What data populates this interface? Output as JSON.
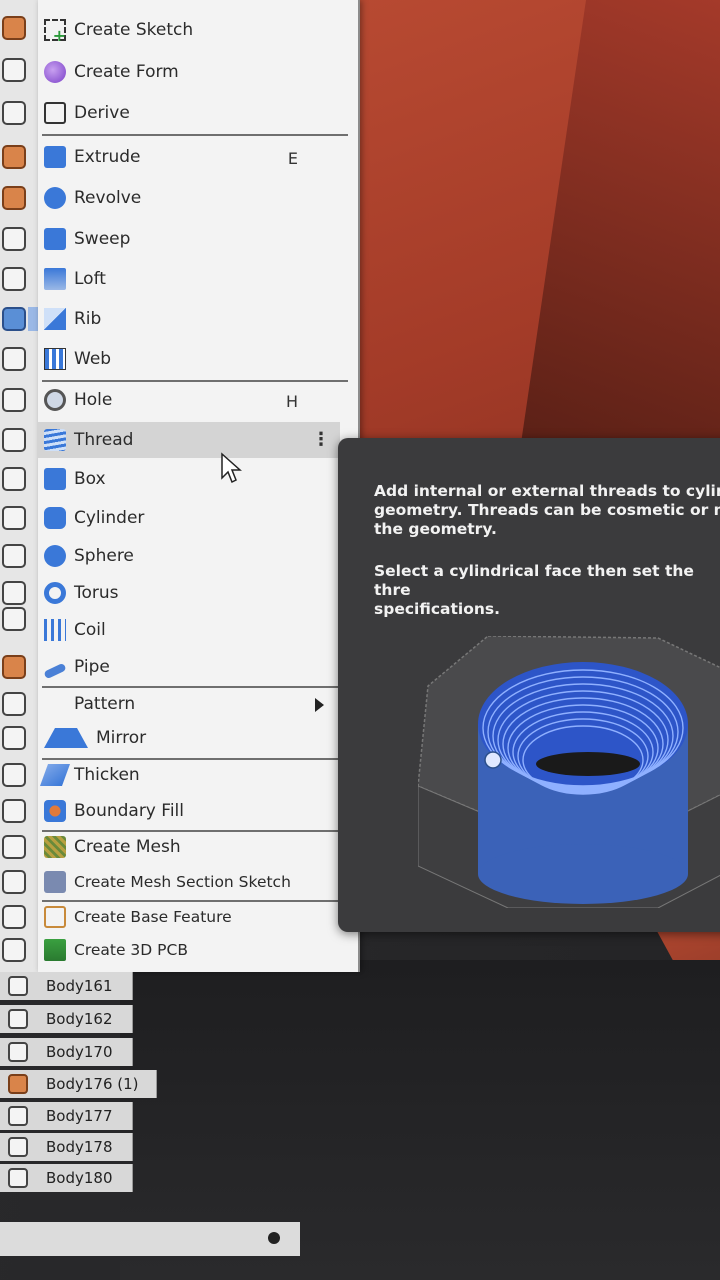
{
  "menu": {
    "items": [
      {
        "id": "create-sketch",
        "label": "Create Sketch",
        "icon": "create-sketch-icon",
        "shortcut": ""
      },
      {
        "id": "create-form",
        "label": "Create Form",
        "icon": "create-form-icon",
        "shortcut": ""
      },
      {
        "id": "derive",
        "label": "Derive",
        "icon": "derive-icon",
        "shortcut": ""
      },
      {
        "id": "extrude",
        "label": "Extrude",
        "icon": "extrude-icon",
        "shortcut": "E"
      },
      {
        "id": "revolve",
        "label": "Revolve",
        "icon": "revolve-icon",
        "shortcut": ""
      },
      {
        "id": "sweep",
        "label": "Sweep",
        "icon": "sweep-icon",
        "shortcut": ""
      },
      {
        "id": "loft",
        "label": "Loft",
        "icon": "loft-icon",
        "shortcut": ""
      },
      {
        "id": "rib",
        "label": "Rib",
        "icon": "rib-icon",
        "shortcut": ""
      },
      {
        "id": "web",
        "label": "Web",
        "icon": "web-icon",
        "shortcut": ""
      },
      {
        "id": "hole",
        "label": "Hole",
        "icon": "hole-icon",
        "shortcut": "H"
      },
      {
        "id": "thread",
        "label": "Thread",
        "icon": "thread-icon",
        "shortcut": "",
        "more": "⋮"
      },
      {
        "id": "box",
        "label": "Box",
        "icon": "box-icon",
        "shortcut": ""
      },
      {
        "id": "cylinder",
        "label": "Cylinder",
        "icon": "cylinder-icon",
        "shortcut": ""
      },
      {
        "id": "sphere",
        "label": "Sphere",
        "icon": "sphere-icon",
        "shortcut": ""
      },
      {
        "id": "torus",
        "label": "Torus",
        "icon": "torus-icon",
        "shortcut": ""
      },
      {
        "id": "coil",
        "label": "Coil",
        "icon": "coil-icon",
        "shortcut": ""
      },
      {
        "id": "pipe",
        "label": "Pipe",
        "icon": "pipe-icon",
        "shortcut": ""
      },
      {
        "id": "pattern",
        "label": "Pattern",
        "icon": "",
        "shortcut": ""
      },
      {
        "id": "mirror",
        "label": "Mirror",
        "icon": "mirror-icon",
        "shortcut": ""
      },
      {
        "id": "thicken",
        "label": "Thicken",
        "icon": "thicken-icon",
        "shortcut": ""
      },
      {
        "id": "boundary-fill",
        "label": "Boundary Fill",
        "icon": "boundary-fill-icon",
        "shortcut": ""
      },
      {
        "id": "create-mesh",
        "label": "Create Mesh",
        "icon": "create-mesh-icon",
        "shortcut": ""
      },
      {
        "id": "create-mesh-section-sketch",
        "label": "Create Mesh Section Sketch",
        "icon": "mesh-section-icon",
        "shortcut": ""
      },
      {
        "id": "create-base-feature",
        "label": "Create Base Feature",
        "icon": "base-feature-icon",
        "shortcut": ""
      },
      {
        "id": "create-3d-pcb",
        "label": "Create 3D PCB",
        "icon": "pcb-icon",
        "shortcut": ""
      }
    ]
  },
  "bodies": [
    {
      "label": "Body161",
      "component": false
    },
    {
      "label": "Body162",
      "component": false
    },
    {
      "label": "Body170",
      "component": false
    },
    {
      "label": "Body176 (1)",
      "component": true
    },
    {
      "label": "Body177",
      "component": false
    },
    {
      "label": "Body178",
      "component": false
    },
    {
      "label": "Body180",
      "component": false
    }
  ],
  "tooltip": {
    "description": "Add internal or external threads to cylin\ngeometry. Threads can be cosmetic or m\nthe geometry.",
    "instruction": "Select a cylindrical face then set the thre\nspecifications."
  },
  "colors": {
    "accent": "#3a78d8",
    "menu_bg": "#f3f3f3",
    "hover_bg": "#d4d4d4",
    "tooltip_bg": "#3b3b3d",
    "viewport_red": "#b84a32"
  }
}
